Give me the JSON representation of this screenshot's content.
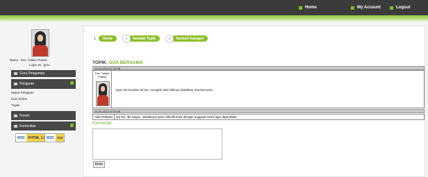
{
  "topnav": {
    "home": "Home",
    "my_account": "My Account",
    "logout": "Logout"
  },
  "sidebar": {
    "name_line": "Nama : Dra. Yuliani Pratiwi",
    "login_line": "Login as : guru",
    "menus": {
      "guru_pengampu": "Guru Pengampu",
      "pelajaran": "Pelajaran",
      "forum": "Forum",
      "komunitas": "Komunitas"
    },
    "submenu": [
      "Materi Pelajaran",
      "Kuis Online",
      "Tugas"
    ],
    "badges": {
      "xhtml": {
        "w3c": "W3C",
        "label": "XHTML 1.0"
      },
      "css": {
        "w3c": "W3C",
        "label": "css"
      }
    }
  },
  "breadcrumb": {
    "steps": [
      "1",
      "2",
      "3"
    ],
    "labels": [
      "Home",
      "Tambah Topik",
      "Tambah Kategori"
    ]
  },
  "topic": {
    "prefix": "TOPIK:",
    "title": "DOA BERSAMA"
  },
  "posts": [
    {
      "timestamp": "19-04-2012 07:30:38",
      "author": "Dra. Yuliani Pratiwi",
      "message": "Agar UN berjalan lancar, mungkin ada baiknya diadakan doa bersama"
    },
    {
      "timestamp": "19-04-2012 07:39:36",
      "author": "Aldo Rahtara",
      "message": "Iya ibu, ide bagus. Sebaiknya perlu dikonfirmasi dengan anggota OSIS agar diperelaan."
    }
  ],
  "komentar": {
    "label": "Komentar:",
    "placeholder": "",
    "button": "Kirim"
  },
  "colors": {
    "accent_green": "#8ebf2c",
    "topbar": "#3b3b3b",
    "menu": "#474747"
  }
}
